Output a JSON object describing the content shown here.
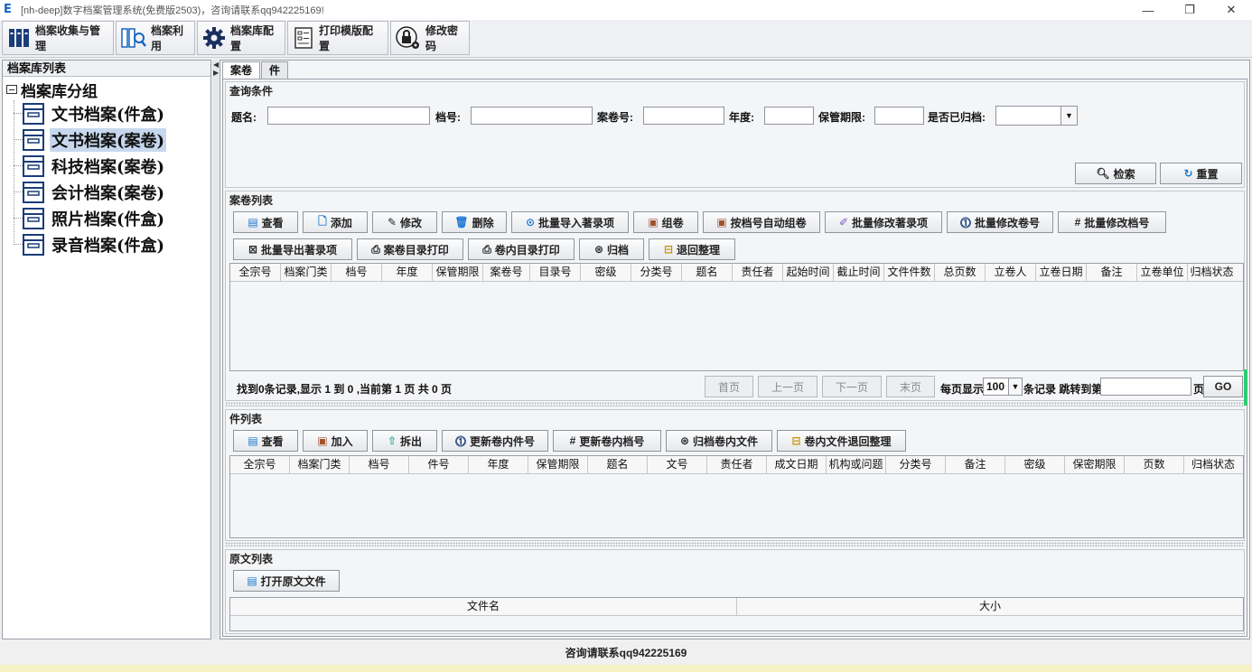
{
  "window": {
    "title": "[nh-deep]数字档案管理系统(免费版2503)，咨询请联系qq942225169!",
    "logo_letter": "E",
    "minimize": "—",
    "maximize": "❐",
    "close": "✕"
  },
  "toolbar": {
    "items": [
      {
        "label": "档案收集与管理",
        "icon": "binders-icon"
      },
      {
        "label": "档案利用",
        "icon": "search-files-icon"
      },
      {
        "label": "档案库配置",
        "icon": "gear-icon"
      },
      {
        "label": "打印模版配置",
        "icon": "template-icon"
      },
      {
        "label": "修改密码",
        "icon": "lock-gear-icon"
      }
    ]
  },
  "left_panel": {
    "header": "档案库列表",
    "root": "档案库分组",
    "items": [
      {
        "label": "文书档案(件盒)"
      },
      {
        "label": "文书档案(案卷)",
        "selected": true
      },
      {
        "label": "科技档案(案卷)"
      },
      {
        "label": "会计档案(案卷)"
      },
      {
        "label": "照片档案(件盒)"
      },
      {
        "label": "录音档案(件盒)"
      }
    ]
  },
  "tabs": [
    "案卷",
    "件"
  ],
  "query": {
    "title": "查询条件",
    "fields": {
      "title_label": "题名:",
      "file_no_label": "档号:",
      "volume_no_label": "案卷号:",
      "year_label": "年度:",
      "retention_label": "保管期限:",
      "archived_label": "是否已归档:"
    },
    "search": "检索",
    "reset": "重置"
  },
  "volume_list": {
    "title": "案卷列表",
    "buttons_row1": [
      "查看",
      "添加",
      "修改",
      "删除",
      "批量导入著录项",
      "组卷",
      "按档号自动组卷",
      "批量修改著录项",
      "批量修改卷号",
      "批量修改档号"
    ],
    "buttons_row2": [
      "批量导出著录项",
      "案卷目录打印",
      "卷内目录打印",
      "归档",
      "退回整理"
    ],
    "columns": [
      "全宗号",
      "档案门类",
      "档号",
      "年度",
      "保管期限",
      "案卷号",
      "目录号",
      "密级",
      "分类号",
      "题名",
      "责任者",
      "起始时间",
      "截止时间",
      "文件件数",
      "总页数",
      "立卷人",
      "立卷日期",
      "备注",
      "立卷单位",
      "归档状态"
    ],
    "pager": {
      "summary": "找到0条记录,显示 1 到 0 ,当前第 1 页 共 0 页",
      "first": "首页",
      "prev": "上一页",
      "next": "下一页",
      "last": "末页",
      "per_page_label": "每页显示",
      "per_page_value": "100",
      "records_jump": "条记录 跳转到第",
      "page_unit": "页",
      "go": "GO"
    }
  },
  "item_list": {
    "title": "件列表",
    "buttons": [
      "查看",
      "加入",
      "拆出",
      "更新卷内件号",
      "更新卷内档号",
      "归档卷内文件",
      "卷内文件退回整理"
    ],
    "columns": [
      "全宗号",
      "档案门类",
      "档号",
      "件号",
      "年度",
      "保管期限",
      "题名",
      "文号",
      "责任者",
      "成文日期",
      "机构或问题",
      "分类号",
      "备注",
      "密级",
      "保密期限",
      "页数",
      "归档状态"
    ]
  },
  "original_list": {
    "title": "原文列表",
    "open_button": "打开原文文件",
    "columns": [
      "文件名",
      "大小"
    ]
  },
  "status_bar": "咨询请联系qq942225169"
}
